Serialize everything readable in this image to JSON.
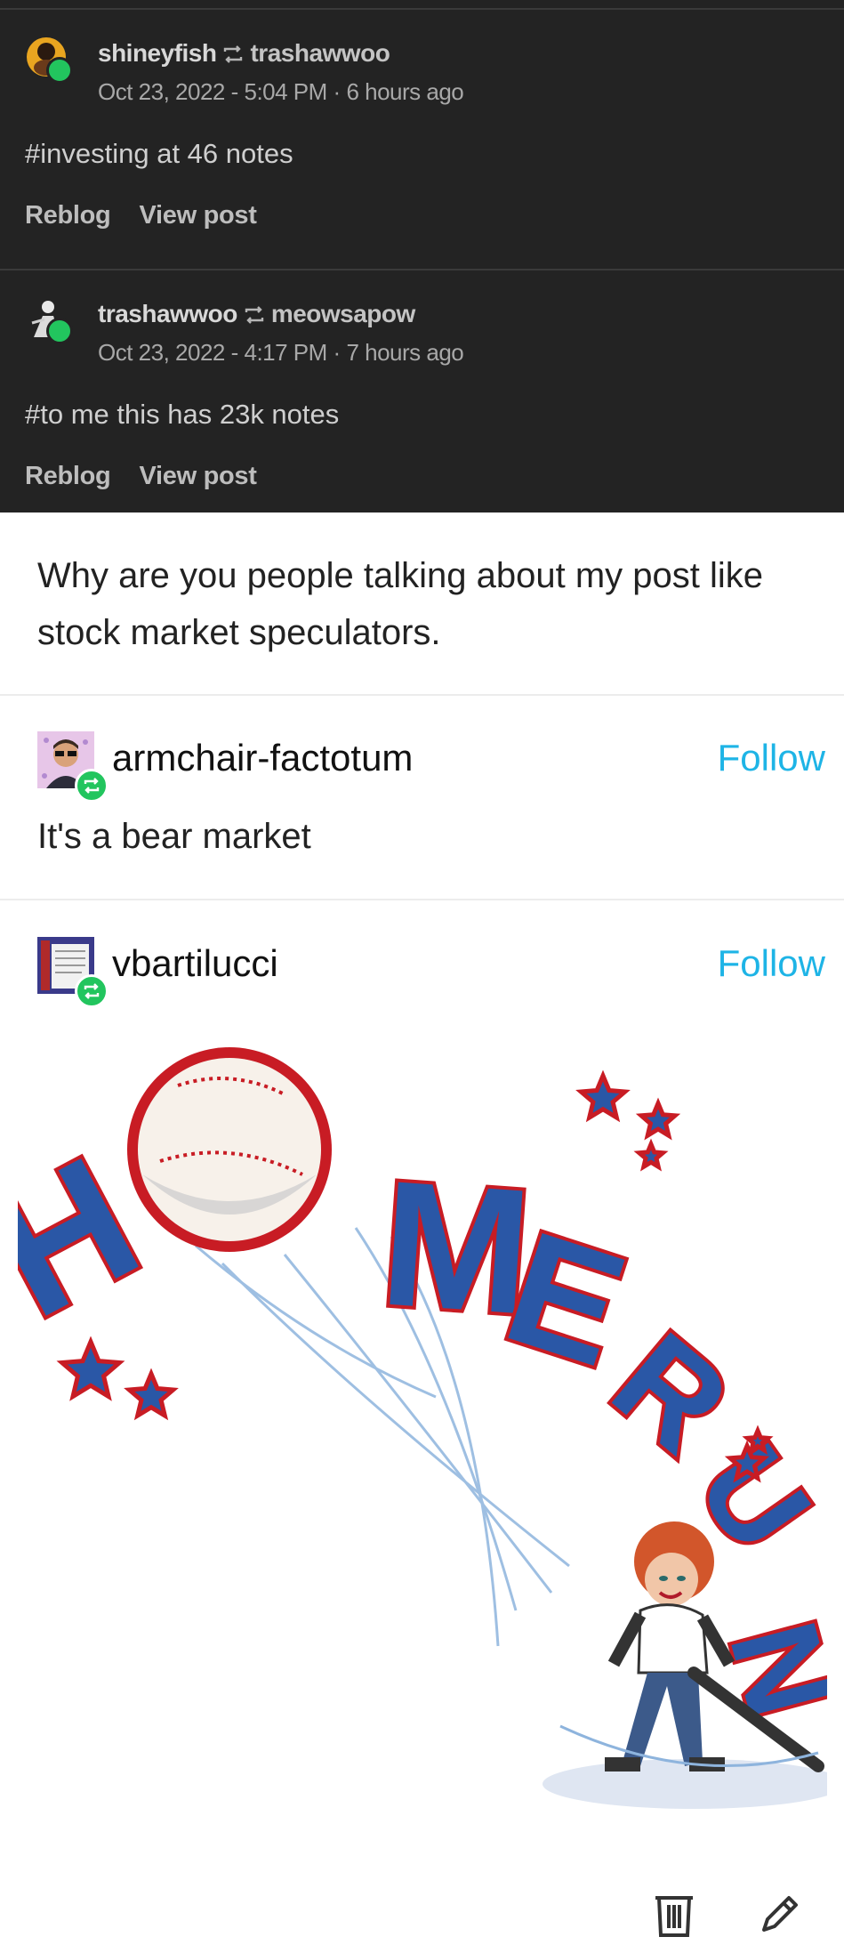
{
  "notes": [
    {
      "user": "shineyfish",
      "reblogged_from": "trashawwoo",
      "date": "Oct 23, 2022 - 5:04 PM",
      "relative": "6 hours ago",
      "tags": "#investing at 46 notes",
      "actions": [
        "Reblog",
        "View post"
      ]
    },
    {
      "user": "trashawwoo",
      "reblogged_from": "meowsapow",
      "date": "Oct 23, 2022 - 4:17 PM",
      "relative": "7 hours ago",
      "tags": "#to me this has 23k notes",
      "actions": [
        "Reblog",
        "View post"
      ]
    }
  ],
  "original_post": {
    "body": "Why are you people talking about my post like stock market speculators."
  },
  "reblogs": [
    {
      "username": "armchair-factotum",
      "follow_label": "Follow",
      "body": "It's a bear market"
    },
    {
      "username": "vbartilucci",
      "follow_label": "Follow",
      "image": "home-run-bitmoji-sticker",
      "image_text": [
        "H",
        "M",
        "E",
        "R",
        "U",
        "N"
      ]
    }
  ],
  "toolbar": {
    "icons": [
      "trash-icon",
      "pencil-icon"
    ]
  },
  "colors": {
    "dark_bg": "#232323",
    "accent_follow": "#1eb4e6",
    "reblog_badge": "#22c55e"
  }
}
